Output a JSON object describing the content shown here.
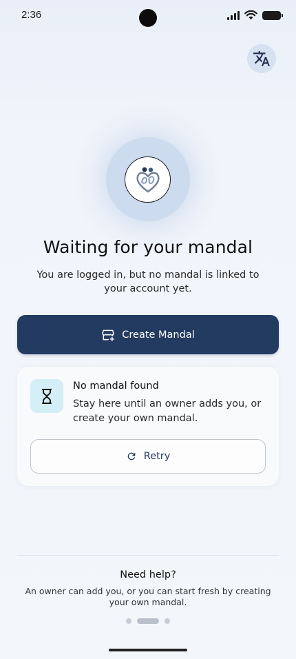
{
  "status_bar": {
    "time": "2:36",
    "icons": [
      "signal-icon",
      "wifi-icon",
      "battery-icon"
    ]
  },
  "header": {
    "language_icon": "translate-icon"
  },
  "hero": {
    "logo_icon": "mandal-logo-icon",
    "title": "Waiting for your mandal",
    "subtitle": "You are logged in, but no mandal is linked to your account yet."
  },
  "actions": {
    "create_label": "Create Mandal",
    "create_icon": "storefront-add-icon"
  },
  "status_card": {
    "icon": "hourglass-icon",
    "title": "No mandal found",
    "text": "Stay here until an owner adds you, or create your own mandal.",
    "retry_label": "Retry",
    "retry_icon": "refresh-icon"
  },
  "help": {
    "title": "Need help?",
    "text": "An owner can add you, or you can start fresh by creating your own mandal."
  },
  "pager": {
    "count": 3,
    "active_index": 1
  },
  "colors": {
    "primary": "#233a61",
    "background": "#f1f5fb",
    "card_icon_bg": "#d4eef7",
    "hero_circle": "#cddbef"
  }
}
